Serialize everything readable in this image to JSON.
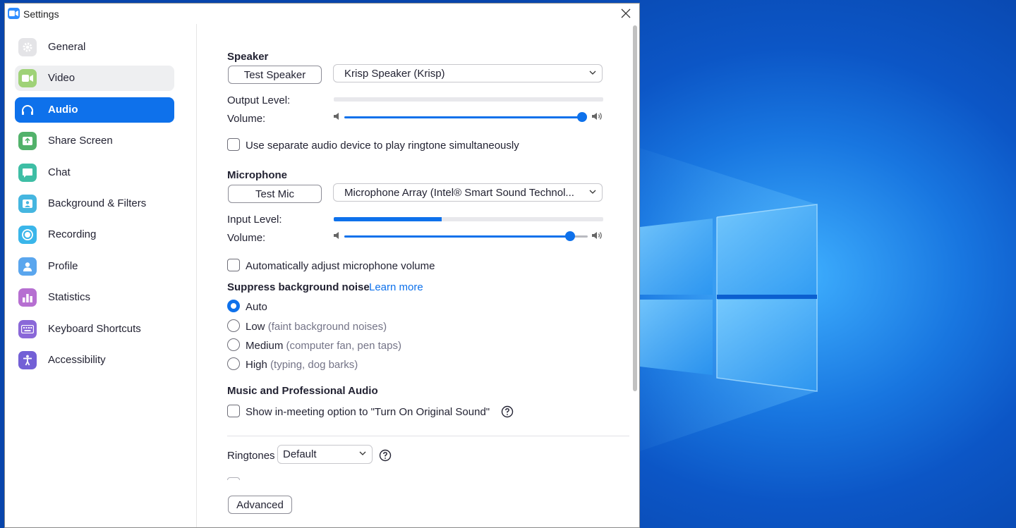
{
  "window": {
    "title": "Settings"
  },
  "colors": {
    "accent": "#0e71eb",
    "desktop": "#0c56c6"
  },
  "sidebar": {
    "items": [
      {
        "label": "General",
        "icon": "gear-icon",
        "color": "#e3e3e6",
        "state": "normal"
      },
      {
        "label": "Video",
        "icon": "video-camera-icon",
        "color": "#9fd277",
        "state": "hover"
      },
      {
        "label": "Audio",
        "icon": "headphones-icon",
        "color": "#0e71eb",
        "state": "active"
      },
      {
        "label": "Share Screen",
        "icon": "share-screen-icon",
        "color": "#52b26b",
        "state": "normal"
      },
      {
        "label": "Chat",
        "icon": "chat-bubble-icon",
        "color": "#3ebea5",
        "state": "normal"
      },
      {
        "label": "Background & Filters",
        "icon": "person-background-icon",
        "color": "#45b6e0",
        "state": "normal"
      },
      {
        "label": "Recording",
        "icon": "record-icon",
        "color": "#3ab6ea",
        "state": "normal"
      },
      {
        "label": "Profile",
        "icon": "user-icon",
        "color": "#5aa6ee",
        "state": "normal"
      },
      {
        "label": "Statistics",
        "icon": "bar-chart-icon",
        "color": "#b66fd1",
        "state": "normal"
      },
      {
        "label": "Keyboard Shortcuts",
        "icon": "keyboard-icon",
        "color": "#8a68d8",
        "state": "normal"
      },
      {
        "label": "Accessibility",
        "icon": "accessibility-icon",
        "color": "#7360d6",
        "state": "normal"
      }
    ]
  },
  "speaker": {
    "title": "Speaker",
    "test_button": "Test Speaker",
    "device": "Krisp Speaker (Krisp)",
    "output_level_label": "Output Level:",
    "output_level": 0,
    "volume_label": "Volume:",
    "volume": 1.0,
    "separate_device_label": "Use separate audio device to play ringtone simultaneously",
    "separate_device_checked": false
  },
  "microphone": {
    "title": "Microphone",
    "test_button": "Test Mic",
    "device": "Microphone Array (Intel® Smart Sound Technol...",
    "input_level_label": "Input Level:",
    "input_level": 0.4,
    "volume_label": "Volume:",
    "volume": 0.95,
    "auto_adjust_label": "Automatically adjust microphone volume",
    "auto_adjust_checked": false
  },
  "noise": {
    "title": "Suppress background noise",
    "learn_more": "Learn more",
    "options": [
      {
        "label": "Auto",
        "hint": "",
        "checked": true
      },
      {
        "label": "Low",
        "hint": "(faint background noises)",
        "checked": false
      },
      {
        "label": "Medium",
        "hint": "(computer fan, pen taps)",
        "checked": false
      },
      {
        "label": "High",
        "hint": "(typing, dog barks)",
        "checked": false
      }
    ]
  },
  "music": {
    "title": "Music and Professional Audio",
    "original_sound_label": "Show in-meeting option to \"Turn On Original Sound\"",
    "original_sound_checked": false
  },
  "ringtones": {
    "label": "Ringtones",
    "value": "Default"
  },
  "advanced_button": "Advanced"
}
